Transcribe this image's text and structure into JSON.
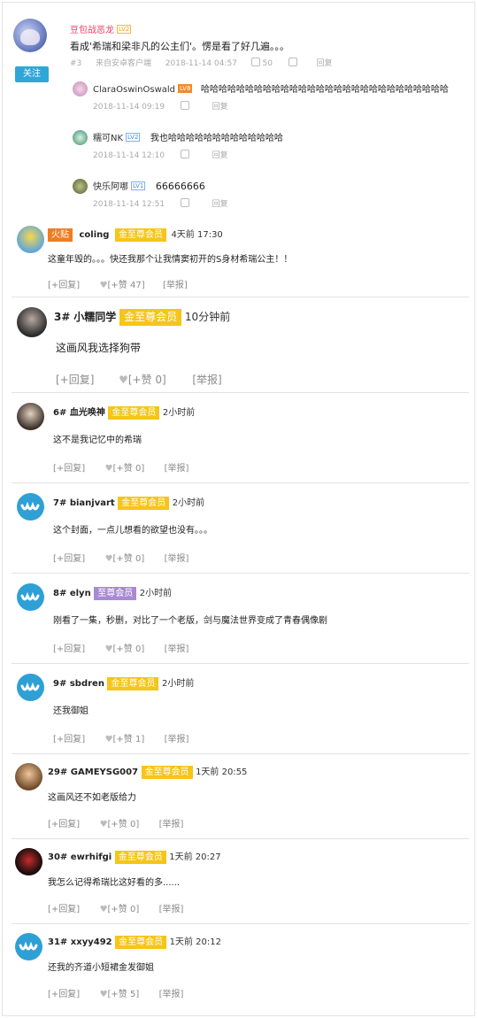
{
  "top_comment": {
    "username": "豆包战恶龙",
    "level": "LV2",
    "text": "看成'希瑞和梁非凡的公主们'。愣是看了好几遍。。。",
    "floor": "#3",
    "source": "来自安卓客户端",
    "timestamp": "2018-11-14 04:57",
    "likes": "50",
    "reply_label": "回复",
    "follow_label": "关注",
    "replies": [
      {
        "username": "ClaraOswinOswald",
        "level": "LV8",
        "text": "哈哈哈哈哈哈哈哈哈哈哈哈哈哈哈哈哈哈哈哈哈哈哈哈哈哈哈哈",
        "timestamp": "2018-11-14 09:19",
        "reply_label": "回复"
      },
      {
        "username": "糯可NK",
        "level": "LV2",
        "text": "我也哈哈哈哈哈哈哈哈哈哈哈哈哈",
        "timestamp": "2018-11-14 12:10",
        "reply_label": "回复"
      },
      {
        "username": "快乐阿哪",
        "level": "LV1",
        "text": "66666666",
        "timestamp": "2018-11-14 12:51",
        "reply_label": "回复"
      }
    ]
  },
  "comments": [
    {
      "prefix": "火贴",
      "floor": "",
      "username": "coling",
      "badge": "金至尊会员",
      "time": "4天前 17:30",
      "text": "这童年毁的。。。快还我那个让我情窦初开的S身材希瑞公主！！",
      "reply": "[+回复]",
      "like": "[+赞 47]",
      "report": "[举报]"
    },
    {
      "prefix": "",
      "floor": "3#",
      "username": "小糯同学",
      "badge": "金至尊会员",
      "time": "10分钟前",
      "text": "这画风我选择狗带",
      "reply": "[+回复]",
      "like": "[+赞 0]",
      "report": "[举报]"
    },
    {
      "prefix": "",
      "floor": "6#",
      "username": "血光唤神",
      "badge": "金至尊会员",
      "time": "2小时前",
      "text": "这不是我记忆中的希瑞",
      "reply": "[+回复]",
      "like": "[+赞 0]",
      "report": "[举报]"
    },
    {
      "prefix": "",
      "floor": "7#",
      "username": "bianjvart",
      "badge": "金至尊会员",
      "time": "2小时前",
      "text": "这个封面，一点儿想看的欲望也没有。。。",
      "reply": "[+回复]",
      "like": "[+赞 0]",
      "report": "[举报]"
    },
    {
      "prefix": "",
      "floor": "8#",
      "username": "elyn",
      "badge": "至尊会员",
      "time": "2小时前",
      "text": "刚看了一集，秒删，对比了一个老版，剑与魔法世界变成了青春偶像剧",
      "reply": "[+回复]",
      "like": "[+赞 0]",
      "report": "[举报]"
    },
    {
      "prefix": "",
      "floor": "9#",
      "username": "sbdren",
      "badge": "金至尊会员",
      "time": "2小时前",
      "text": "还我御姐",
      "reply": "[+回复]",
      "like": "[+赞 1]",
      "report": "[举报]"
    },
    {
      "prefix": "",
      "floor": "29#",
      "username": "GAMEYSG007",
      "badge": "金至尊会员",
      "time": "1天前 20:55",
      "text": "这画风还不如老版给力",
      "reply": "[+回复]",
      "like": "[+赞 0]",
      "report": "[举报]"
    },
    {
      "prefix": "",
      "floor": "30#",
      "username": "ewrhifgi",
      "badge": "金至尊会员",
      "time": "1天前 20:27",
      "text": "我怎么记得希瑞比这好看的多......",
      "reply": "[+回复]",
      "like": "[+赞 0]",
      "report": "[举报]"
    },
    {
      "prefix": "",
      "floor": "31#",
      "username": "xxyy492",
      "badge": "金至尊会员",
      "time": "1天前 20:12",
      "text": "还我的齐道小短裙金发御姐",
      "reply": "[+回复]",
      "like": "[+赞 5]",
      "report": "[举报]"
    }
  ],
  "colors": {
    "accent": "#2ea7d8",
    "gold_badge": "#f5c519",
    "purple_badge": "#a88ad2",
    "fire_badge": "#ef7d22"
  }
}
